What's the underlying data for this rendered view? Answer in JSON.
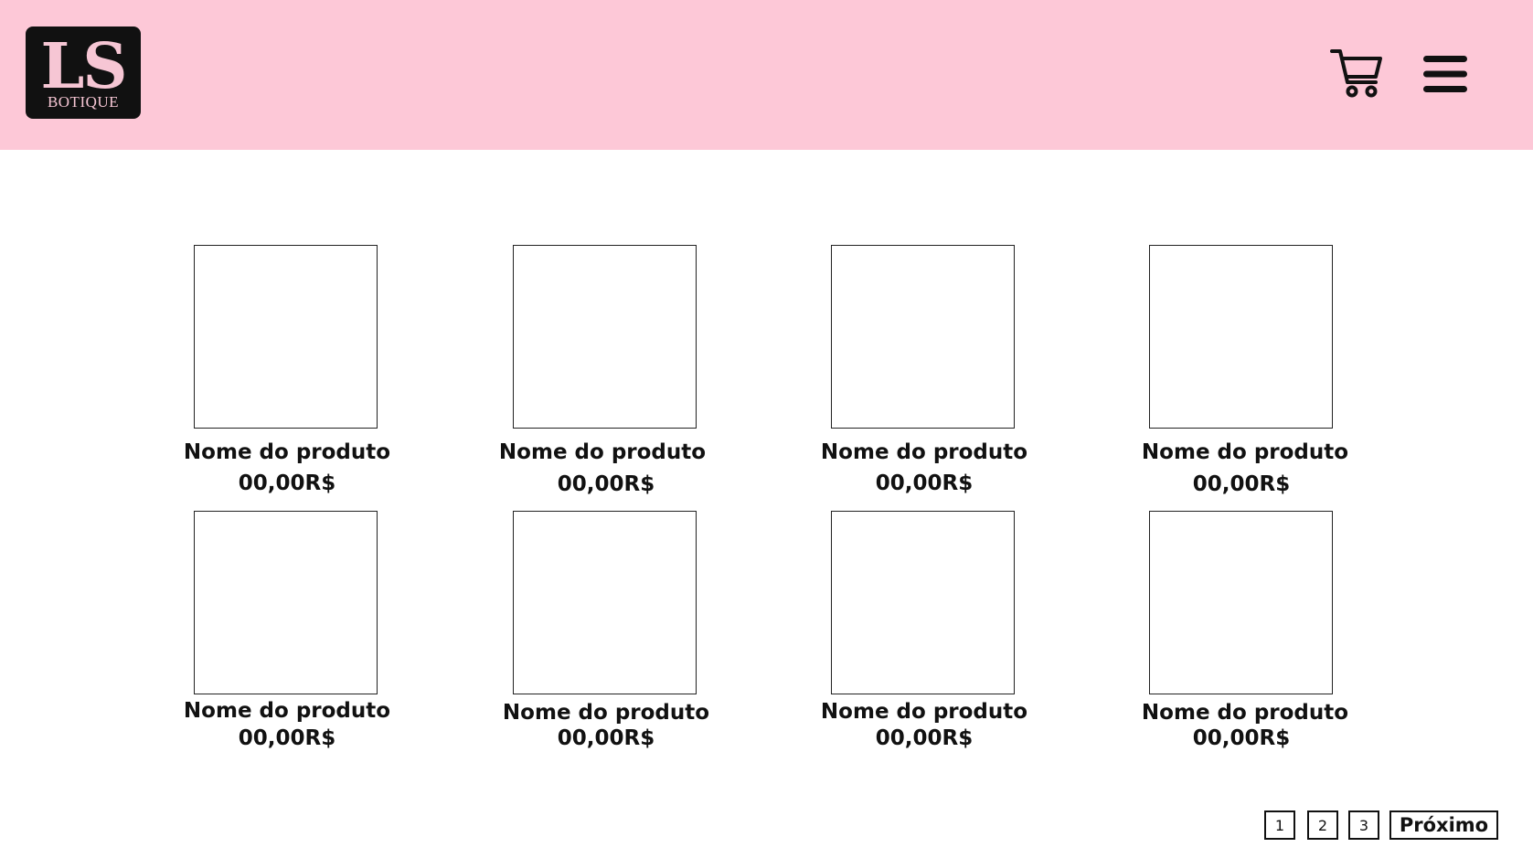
{
  "header": {
    "background_color": "#fdc8d7",
    "logo": {
      "mark": "LS",
      "subtitle": "BOTIQUE"
    },
    "icons": [
      "cart-icon",
      "menu-icon"
    ]
  },
  "products": [
    {
      "name": "Nome do produto",
      "price": "00,00R$"
    },
    {
      "name": "Nome do produto",
      "price": "00,00R$"
    },
    {
      "name": "Nome do produto",
      "price": "00,00R$"
    },
    {
      "name": "Nome do produto",
      "price": "00,00R$"
    },
    {
      "name": "Nome do produto",
      "price": "00,00R$"
    },
    {
      "name": "Nome do produto",
      "price": "00,00R$"
    },
    {
      "name": "Nome do produto",
      "price": "00,00R$"
    },
    {
      "name": "Nome do produto",
      "price": "00,00R$"
    }
  ],
  "pagination": {
    "pages": [
      "1",
      "2",
      "3"
    ],
    "next_label": "Próximo"
  }
}
